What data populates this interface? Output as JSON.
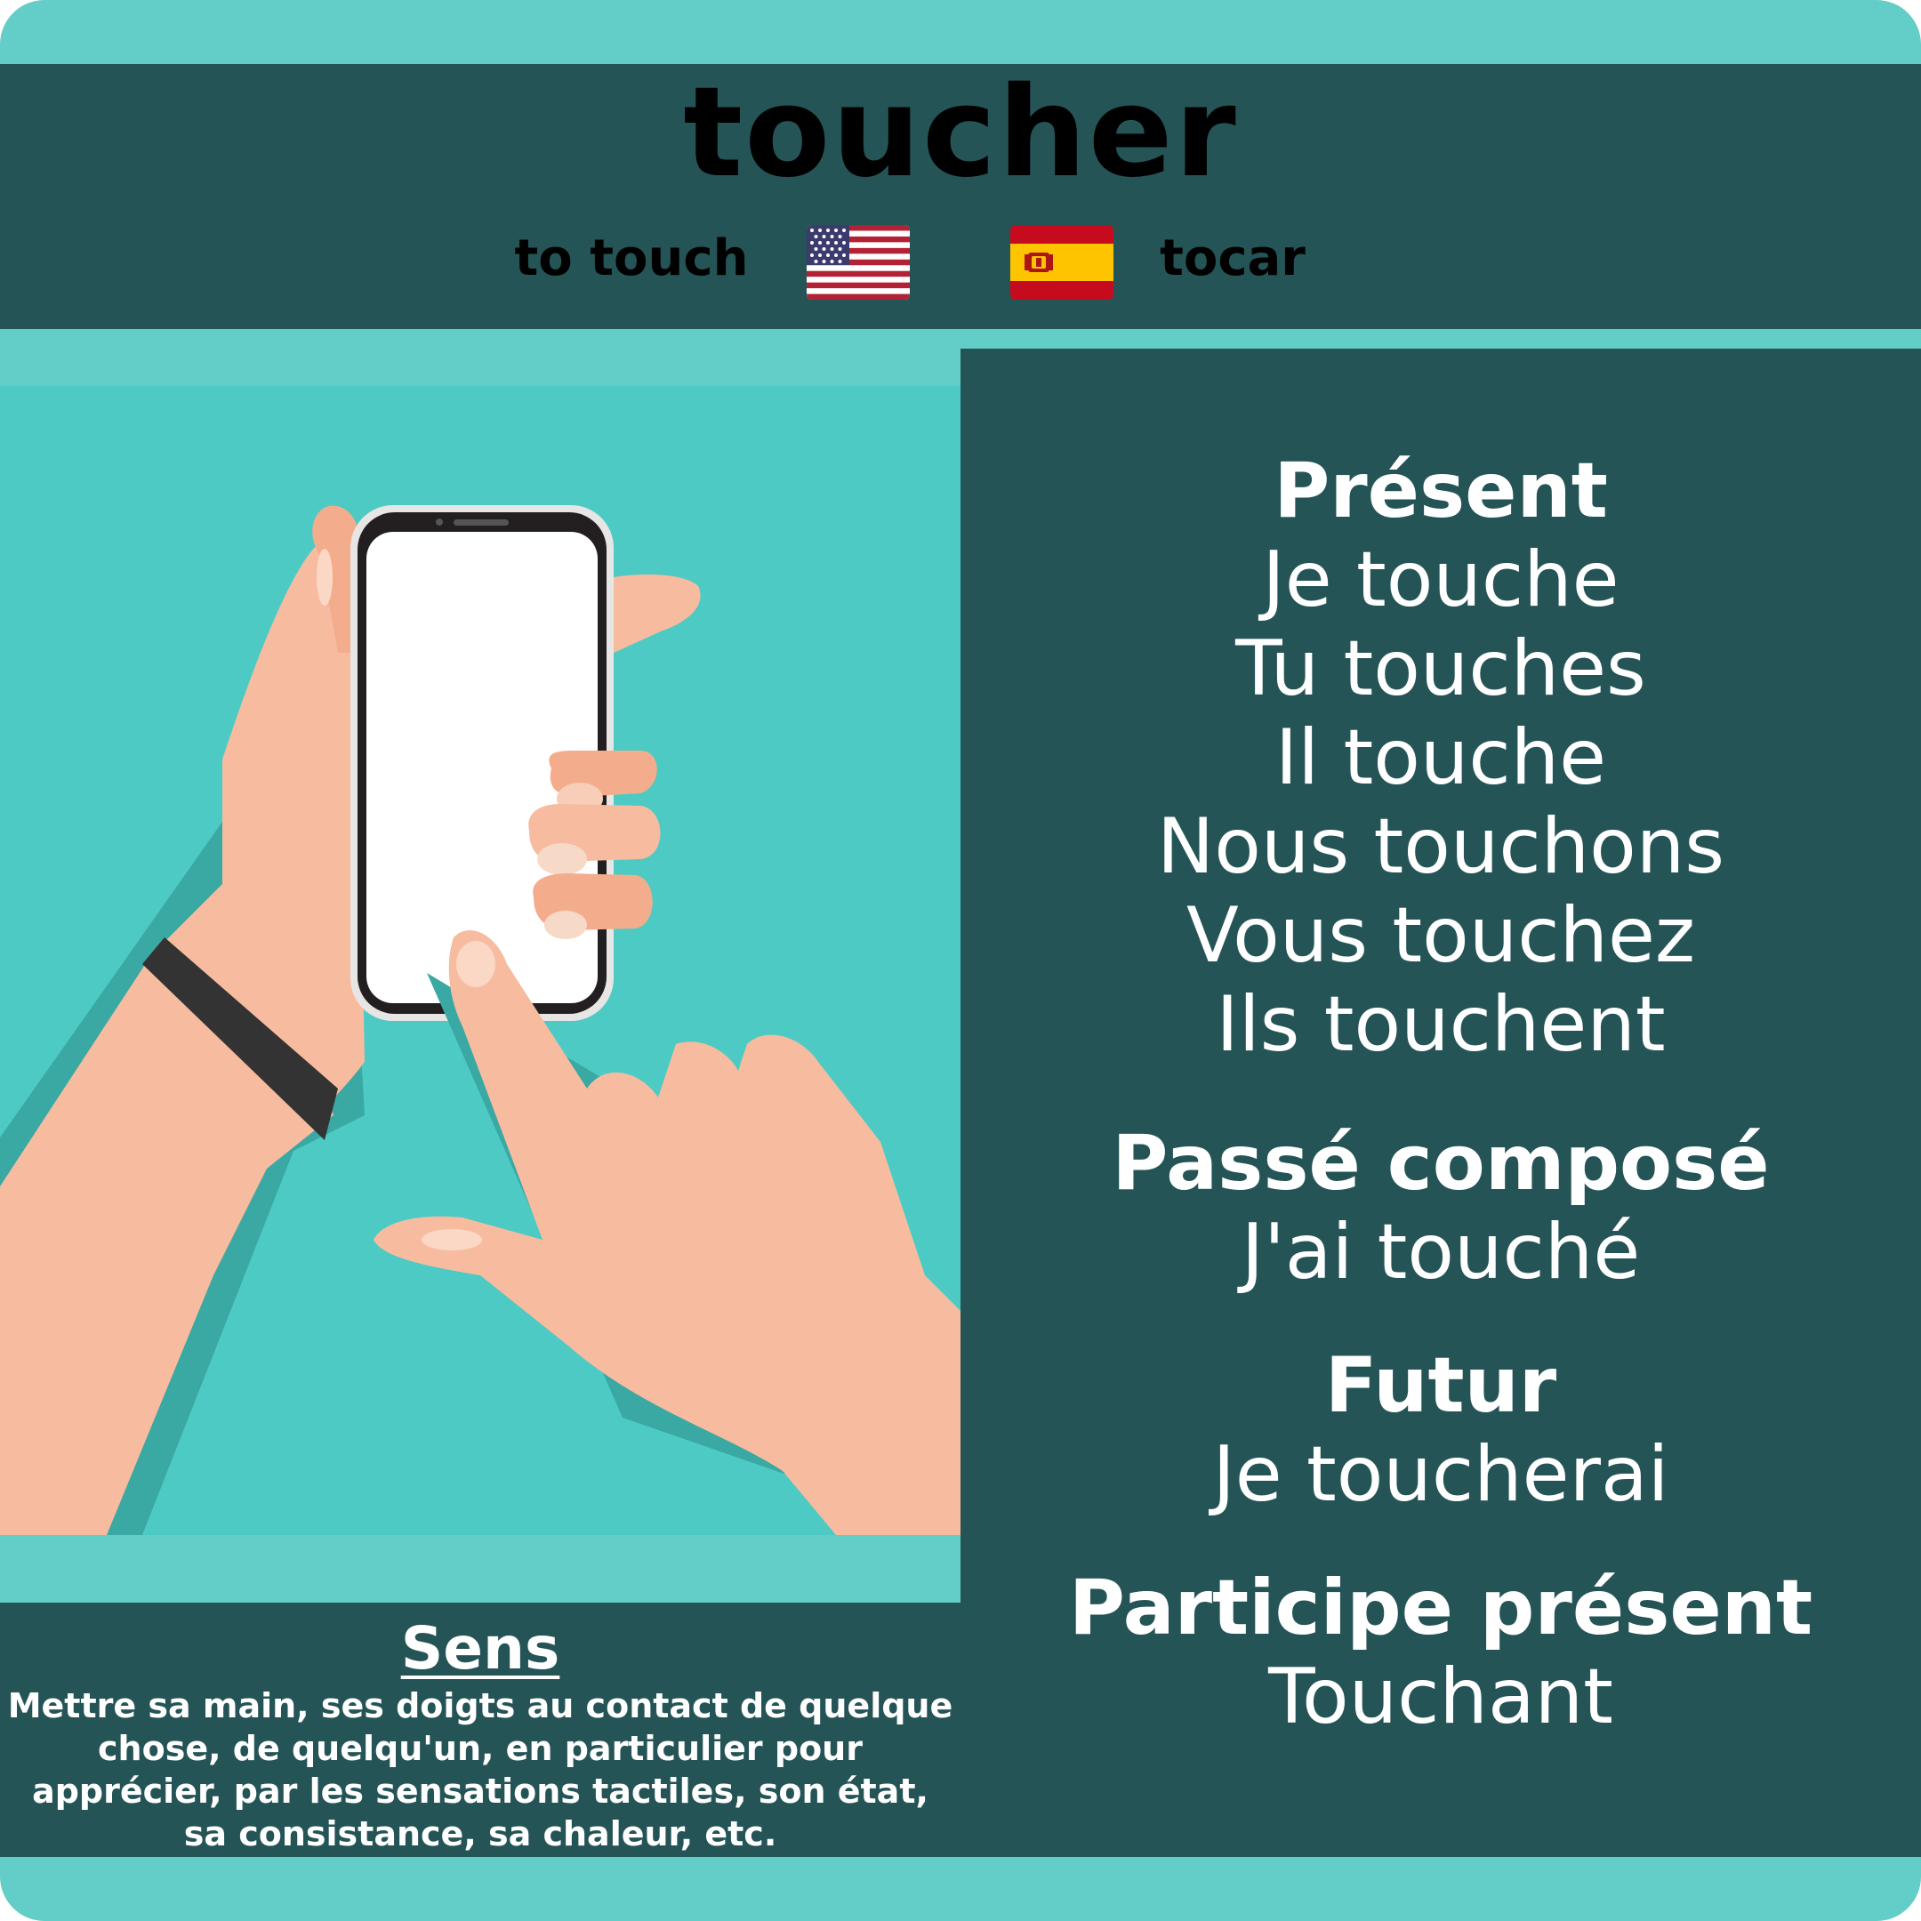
{
  "verb": "toucher",
  "translations": {
    "english": "to touch",
    "spanish": "tocar",
    "english_flag_icon": "us-flag-icon",
    "spanish_flag_icon": "spain-flag-icon"
  },
  "illustration": {
    "subject": "hands-holding-smartphone",
    "colors": {
      "background": "#4ecac4",
      "skin": "#f7bc9f",
      "phone": "#231f20",
      "screen": "#ffffff",
      "strap": "#333333"
    }
  },
  "conjugations": {
    "present": {
      "label": "Présent",
      "forms": [
        "Je touche",
        "Tu touches",
        "Il touche",
        "Nous touchons",
        "Vous touchez",
        "Ils touchent"
      ]
    },
    "passe_compose": {
      "label": "Passé composé",
      "form": "J'ai touché"
    },
    "futur": {
      "label": "Futur",
      "form": "Je toucherai"
    },
    "participe_present": {
      "label": "Participe présent",
      "form": "Touchant"
    }
  },
  "sens": {
    "label": "Sens",
    "definition": "Mettre sa main, ses doigts au contact de quelque chose, de quelqu'un, en particulier pour apprécier, par les sensations tactiles, son état, sa consistance, sa chaleur, etc."
  },
  "colors": {
    "frame": "#63cdc7",
    "dark_panel": "#255457",
    "text": "#ffffff"
  }
}
